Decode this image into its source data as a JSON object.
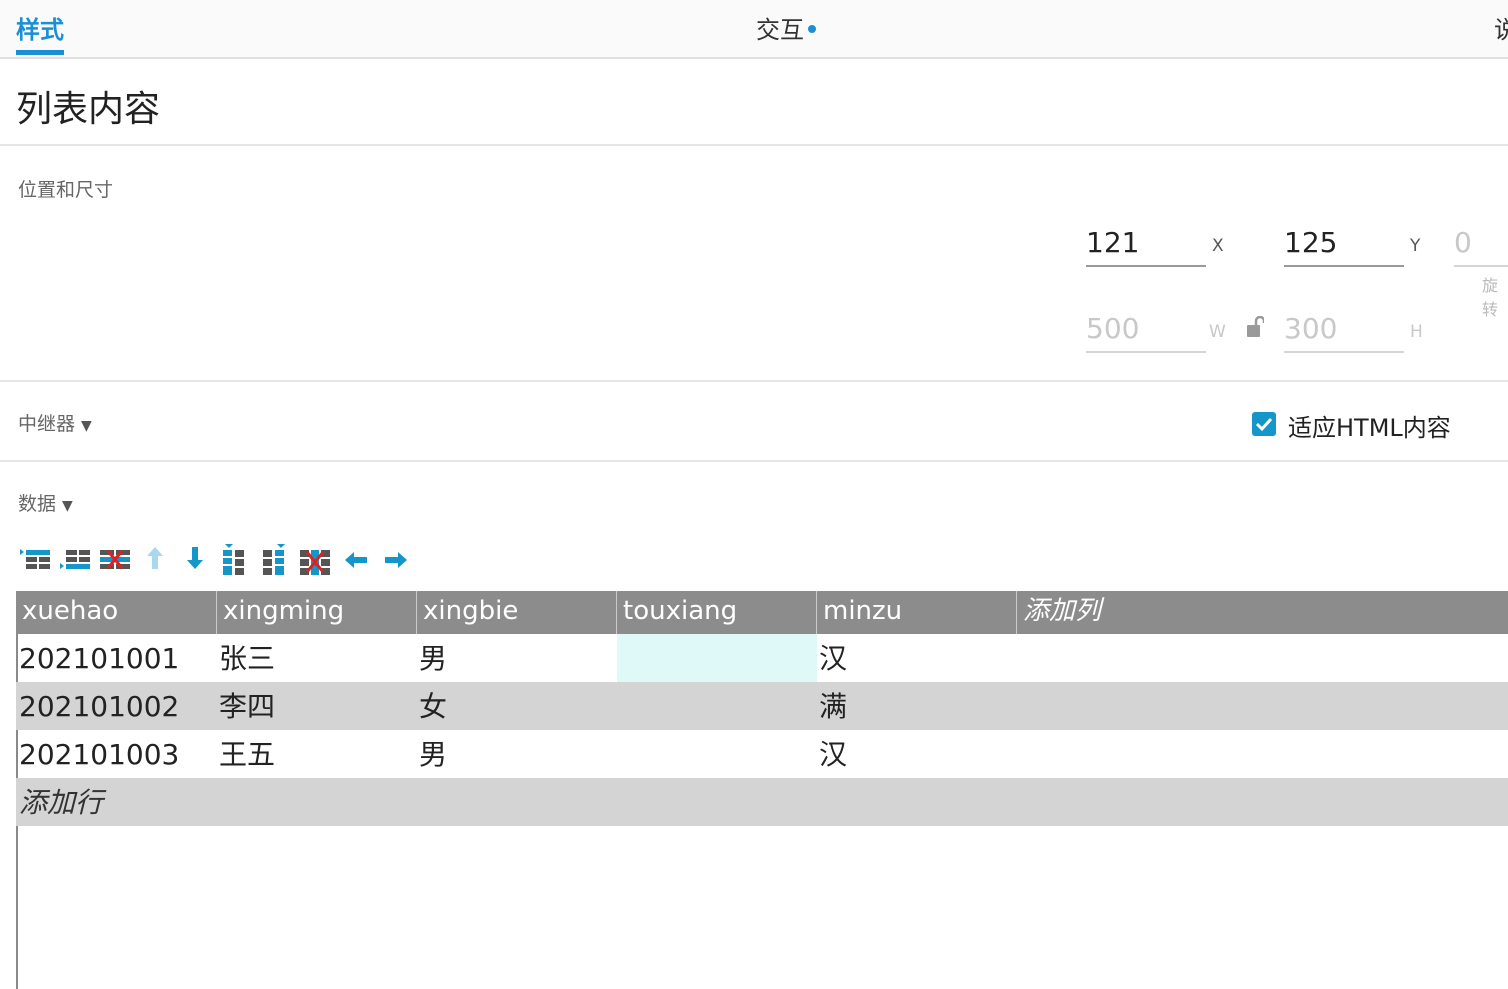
{
  "tabs": {
    "style": "样式",
    "interact": "交互",
    "desc": "说"
  },
  "widget_title": "列表内容",
  "position_size": {
    "label": "位置和尺寸",
    "x": "121",
    "x_unit": "X",
    "y": "125",
    "y_unit": "Y",
    "rotation": "0",
    "rotation_label": "旋转",
    "w": "500",
    "w_unit": "W",
    "h": "300",
    "h_unit": "H"
  },
  "repeater": {
    "label": "中继器",
    "caret": "▼",
    "fit_html_label": "适应HTML内容",
    "fit_html_checked": true
  },
  "data_section": {
    "label": "数据",
    "caret": "▼"
  },
  "toolbar": {
    "icons": [
      "insert-row-above-icon",
      "insert-row-below-icon",
      "delete-row-icon",
      "move-up-icon",
      "move-down-icon",
      "insert-column-left-icon",
      "insert-column-right-icon",
      "delete-column-icon",
      "move-left-icon",
      "move-right-icon"
    ]
  },
  "table": {
    "columns": [
      "xuehao",
      "xingming",
      "xingbie",
      "touxiang",
      "minzu",
      "添加列"
    ],
    "rows": [
      [
        "202101001",
        "张三",
        "男",
        "",
        "汉"
      ],
      [
        "202101002",
        "李四",
        "女",
        "",
        "满"
      ],
      [
        "202101003",
        "王五",
        "男",
        "",
        "汉"
      ]
    ],
    "add_row": "添加行"
  },
  "colors": {
    "accent": "#1a8fd6",
    "header_bg": "#8c8c8c",
    "alt_row": "#d4d4d4",
    "selected_cell": "#dff8f8"
  }
}
